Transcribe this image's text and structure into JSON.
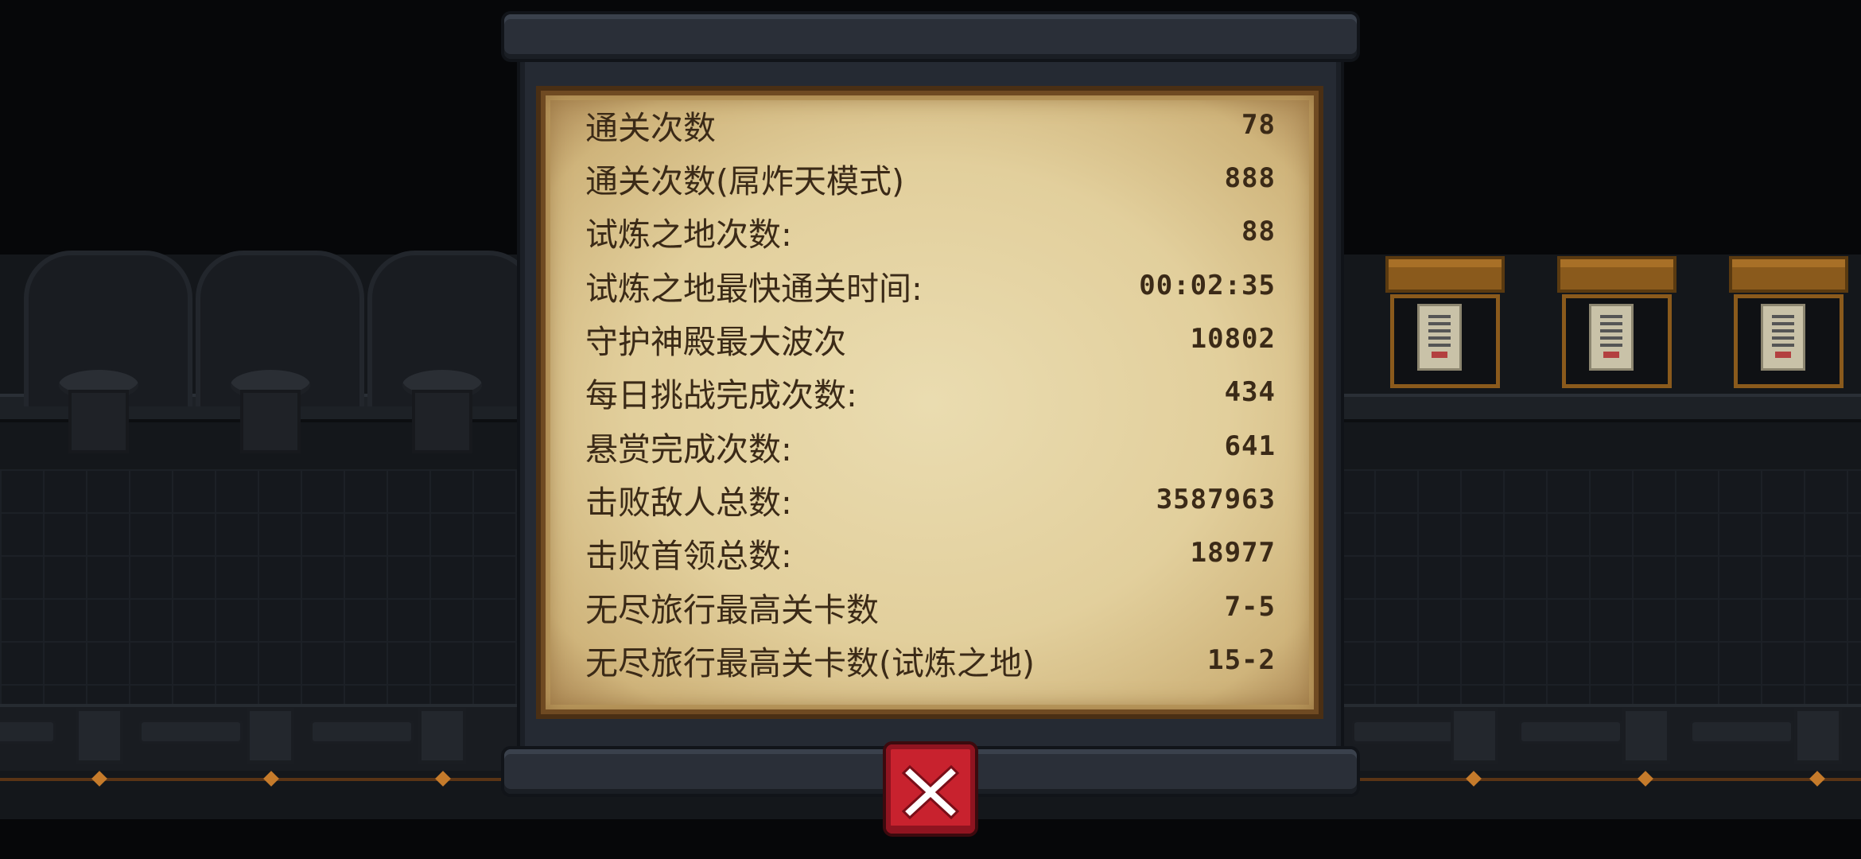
{
  "stats": [
    {
      "label": "通关次数",
      "value": "78"
    },
    {
      "label": "通关次数(屌炸天模式)",
      "value": "888"
    },
    {
      "label": "试炼之地次数:",
      "value": "88"
    },
    {
      "label": "试炼之地最快通关时间:",
      "value": "00:02:35"
    },
    {
      "label": "守护神殿最大波次",
      "value": "10802"
    },
    {
      "label": "每日挑战完成次数:",
      "value": "434"
    },
    {
      "label": "悬赏完成次数:",
      "value": "641"
    },
    {
      "label": "击败敌人总数:",
      "value": "3587963"
    },
    {
      "label": "击败首领总数:",
      "value": "18977"
    },
    {
      "label": "无尽旅行最高关卡数",
      "value": "7-5"
    },
    {
      "label": "无尽旅行最高关卡数(试炼之地)",
      "value": "15-2"
    }
  ],
  "close_button": {
    "icon": "close-icon"
  },
  "colors": {
    "parchment": "#e2cf9c",
    "text": "#3b2a17",
    "close_button": "#c8222e",
    "scroll_rod": "#2a2f38",
    "background": "#060709"
  }
}
